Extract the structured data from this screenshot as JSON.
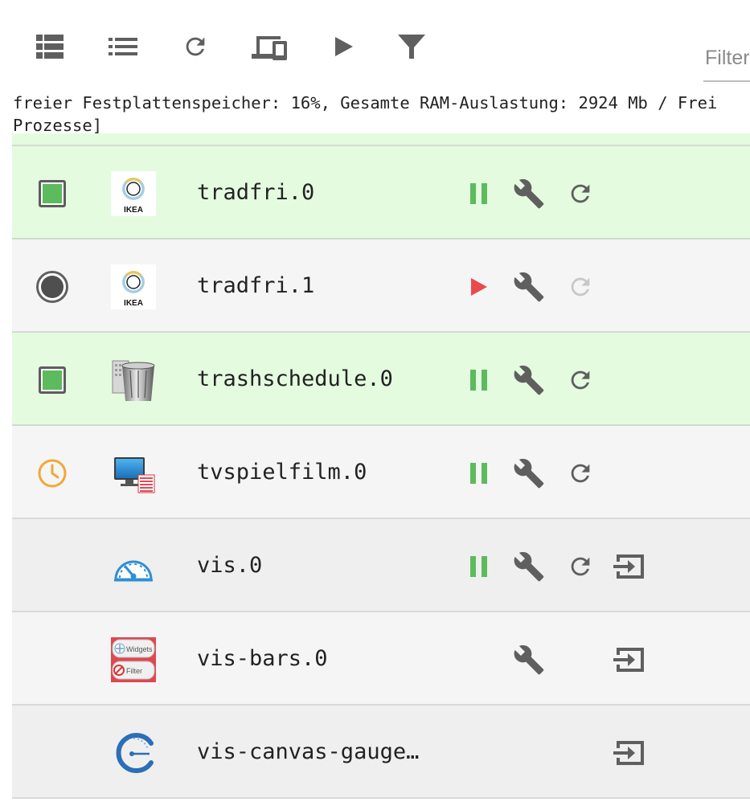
{
  "toolbar": {
    "buttons": [
      {
        "name": "view-table-button",
        "icon": "view-table-icon"
      },
      {
        "name": "view-list-button",
        "icon": "view-list-icon"
      },
      {
        "name": "reload-button",
        "icon": "reload-icon"
      },
      {
        "name": "devices-button",
        "icon": "devices-icon"
      },
      {
        "name": "play-button",
        "icon": "play-icon"
      },
      {
        "name": "filter-button",
        "icon": "filter-icon"
      }
    ],
    "filter_placeholder": "Filter"
  },
  "status_line1": "freier Festplattenspeicher: 16%, Gesamte RAM-Auslastung: 2924 Mb / Frei",
  "status_line2": "Prozesse]",
  "colors": {
    "running_bg": "#e4fbe0",
    "stopped_bg": "#f5f5f5",
    "green": "#5cbb5c",
    "red": "#e84b4b",
    "orange": "#f0a838",
    "icon_gray": "#5f5f5f"
  },
  "adapters": [
    {
      "name": "tradfri.0",
      "status": "running",
      "logo": "ikea-logo",
      "actions": [
        "pause",
        "settings",
        "reload"
      ]
    },
    {
      "name": "tradfri.1",
      "status": "stopped",
      "logo": "ikea-logo",
      "actions": [
        "start",
        "settings",
        "reload-disabled"
      ]
    },
    {
      "name": "trashschedule.0",
      "status": "running",
      "logo": "trash-logo",
      "actions": [
        "pause",
        "settings",
        "reload"
      ]
    },
    {
      "name": "tvspielfilm.0",
      "status": "scheduled",
      "logo": "tv-logo",
      "actions": [
        "pause",
        "settings",
        "reload"
      ]
    },
    {
      "name": "vis.0",
      "status": "none",
      "logo": "gauge-logo",
      "actions": [
        "pause",
        "settings",
        "reload",
        "open"
      ]
    },
    {
      "name": "vis-bars.0",
      "status": "none",
      "logo": "widgets-filter-logo",
      "actions": [
        "settings",
        "open"
      ]
    },
    {
      "name": "vis-canvas-gauge…",
      "status": "none",
      "logo": "canvas-gauge-logo",
      "actions": [
        "open"
      ]
    }
  ]
}
